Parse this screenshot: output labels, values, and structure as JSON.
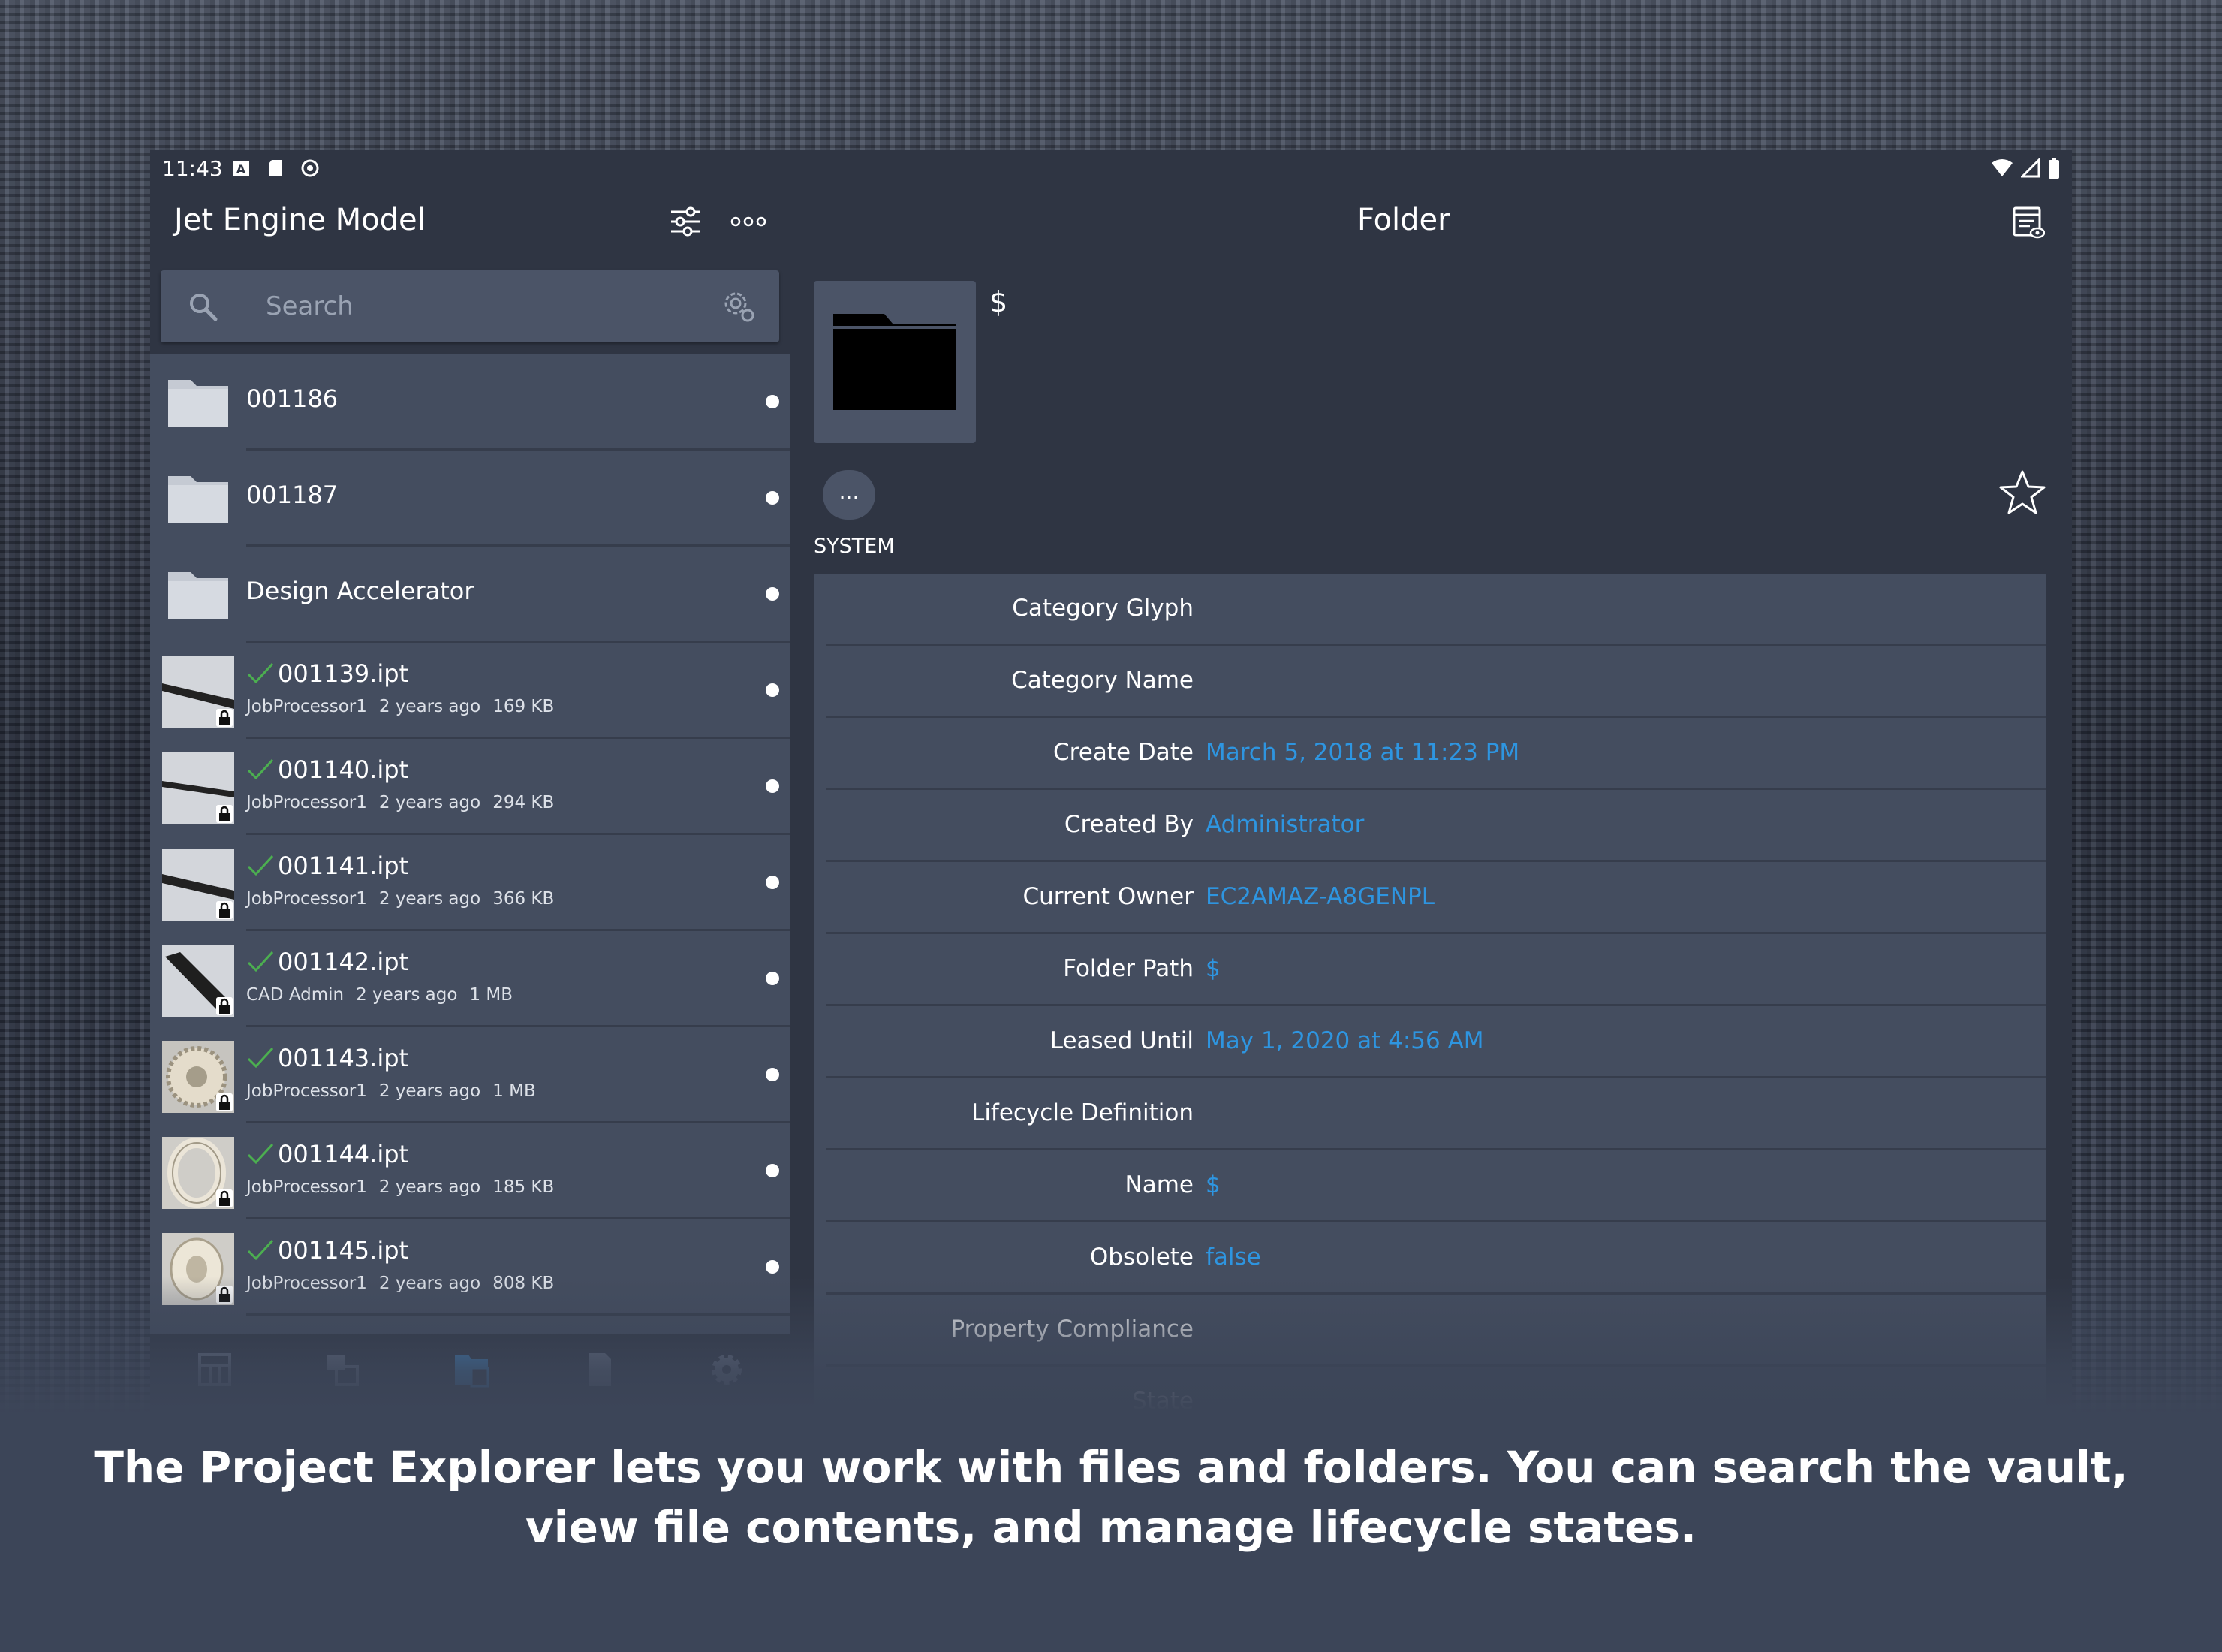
{
  "status_bar": {
    "time": "11:43"
  },
  "left_pane": {
    "title": "Jet Engine Model",
    "search": {
      "placeholder": "Search"
    },
    "items": [
      {
        "type": "folder",
        "name": "001186"
      },
      {
        "type": "folder",
        "name": "001187"
      },
      {
        "type": "folder",
        "name": "Design Accelerator"
      },
      {
        "type": "file",
        "name": "001139.ipt",
        "author": "JobProcessor1",
        "age": "2 years ago",
        "size": "169 KB",
        "thumb": "shaft"
      },
      {
        "type": "file",
        "name": "001140.ipt",
        "author": "JobProcessor1",
        "age": "2 years ago",
        "size": "294 KB",
        "thumb": "shaft"
      },
      {
        "type": "file",
        "name": "001141.ipt",
        "author": "JobProcessor1",
        "age": "2 years ago",
        "size": "366 KB",
        "thumb": "shaft"
      },
      {
        "type": "file",
        "name": "001142.ipt",
        "author": "CAD Admin",
        "age": "2 years ago",
        "size": "1 MB",
        "thumb": "blade"
      },
      {
        "type": "file",
        "name": "001143.ipt",
        "author": "JobProcessor1",
        "age": "2 years ago",
        "size": "1 MB",
        "thumb": "gear"
      },
      {
        "type": "file",
        "name": "001144.ipt",
        "author": "JobProcessor1",
        "age": "2 years ago",
        "size": "185 KB",
        "thumb": "ring"
      },
      {
        "type": "file",
        "name": "001145.ipt",
        "author": "JobProcessor1",
        "age": "2 years ago",
        "size": "808 KB",
        "thumb": "disc"
      }
    ]
  },
  "right_pane": {
    "title": "Folder",
    "folder_name": "$",
    "actions_label": "...",
    "section": "SYSTEM",
    "properties": [
      {
        "label": "Category Glyph",
        "value": ""
      },
      {
        "label": "Category Name",
        "value": ""
      },
      {
        "label": "Create Date",
        "value": "March 5, 2018 at 11:23 PM"
      },
      {
        "label": "Created By",
        "value": "Administrator"
      },
      {
        "label": "Current Owner",
        "value": "EC2AMAZ-A8GENPL"
      },
      {
        "label": "Folder Path",
        "value": "$"
      },
      {
        "label": "Leased Until",
        "value": "May 1, 2020 at 4:56 AM"
      },
      {
        "label": "Lifecycle Definition",
        "value": ""
      },
      {
        "label": "Name",
        "value": "$"
      },
      {
        "label": "Obsolete",
        "value": "false"
      },
      {
        "label": "Property Compliance",
        "value": ""
      },
      {
        "label": "State",
        "value": ""
      }
    ]
  },
  "caption": {
    "line1": "The Project Explorer lets you work with files and folders. You can search the vault,",
    "line2": "view file contents, and manage lifecycle states."
  },
  "colors": {
    "accent": "#2e95e0",
    "check": "#4caf50",
    "panel": "#444d5f",
    "screen": "#2f3543"
  }
}
